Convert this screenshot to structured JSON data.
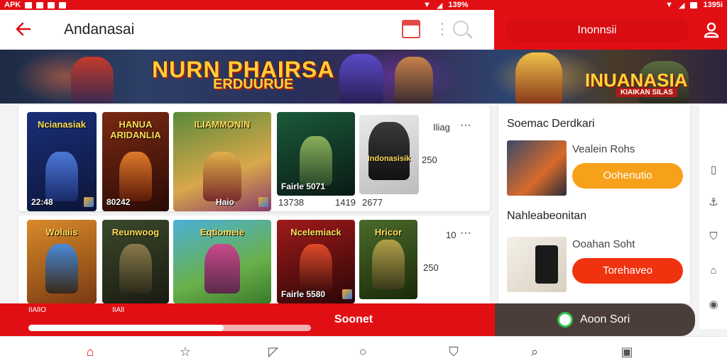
{
  "status_bar": {
    "left_text": "APK",
    "battery_text": "139%",
    "right_text": "1395i"
  },
  "header": {
    "back_icon": "arrow-left-icon",
    "title": "Andanasai",
    "calendar_icon": "calendar-icon",
    "more_icon": "more-vertical-icon",
    "search_icon": "search-icon"
  },
  "top_right": {
    "pill_label": "Inonnsii",
    "profile_icon": "profile-icon"
  },
  "banner": {
    "title": "NURN PHAIRSA",
    "subtitle": "ERDUURUE",
    "logo": "INUANASIA",
    "logo_sub": "KIAIKAN SILAS"
  },
  "grid": {
    "row1": [
      {
        "title": "Ncianasiak",
        "footer": "22:48"
      },
      {
        "title": "HANUA ARIDANLIA",
        "footer": "80242"
      },
      {
        "title": "ILIAMMONIN",
        "footer": "Haio"
      },
      {
        "title": "",
        "footer": "Fairle 5071"
      },
      {
        "title": "Indonasisik",
        "footer": ""
      }
    ],
    "row1_meta": {
      "label": "Iliag",
      "more": "···",
      "count": "250",
      "sub1": "13738",
      "sub2": "1419",
      "sub3": "2677"
    },
    "row2": [
      {
        "title": "Wolaiis",
        "footer": ""
      },
      {
        "title": "Reunwoog",
        "footer": ""
      },
      {
        "title": "Eqtiomeie",
        "footer": ""
      },
      {
        "title": "Ncelemiack",
        "footer": "Fairle 5580"
      },
      {
        "title": "Hricor",
        "footer": ""
      }
    ],
    "row2_meta": {
      "label": "10",
      "more": "···",
      "count": "250"
    }
  },
  "side_panel": {
    "heading1": "Soemac Derdkari",
    "item1": {
      "label": "Vealein Rohs",
      "button": "Oohenutio",
      "button_color": "#f7a11a"
    },
    "heading2": "Nahleabeonitan",
    "item2": {
      "label": "Ooahan Soht",
      "button": "Torehaveo",
      "button_color": "#f0330f"
    }
  },
  "side_rail": {
    "icons": [
      "tablet-icon",
      "anchor-icon",
      "shield-icon",
      "home-icon",
      "eye-icon"
    ]
  },
  "action_bar": {
    "left_small_1": "IIAlIO",
    "left_small_2": "IIAlI",
    "progress": 0.69,
    "center_label": "Soonet",
    "dark_button_label": "Aoon Sori",
    "dark_button_icon": "android-icon"
  },
  "bottom_nav": {
    "icons": [
      "home-icon",
      "star-icon",
      "chat-icon",
      "circle-icon",
      "bookmark-icon",
      "search-icon",
      "app-icon"
    ]
  },
  "colors": {
    "accent": "#e10f14",
    "orange_button": "#f7a11a",
    "red_button": "#f0330f",
    "dark_button": "#4a3d3a"
  }
}
